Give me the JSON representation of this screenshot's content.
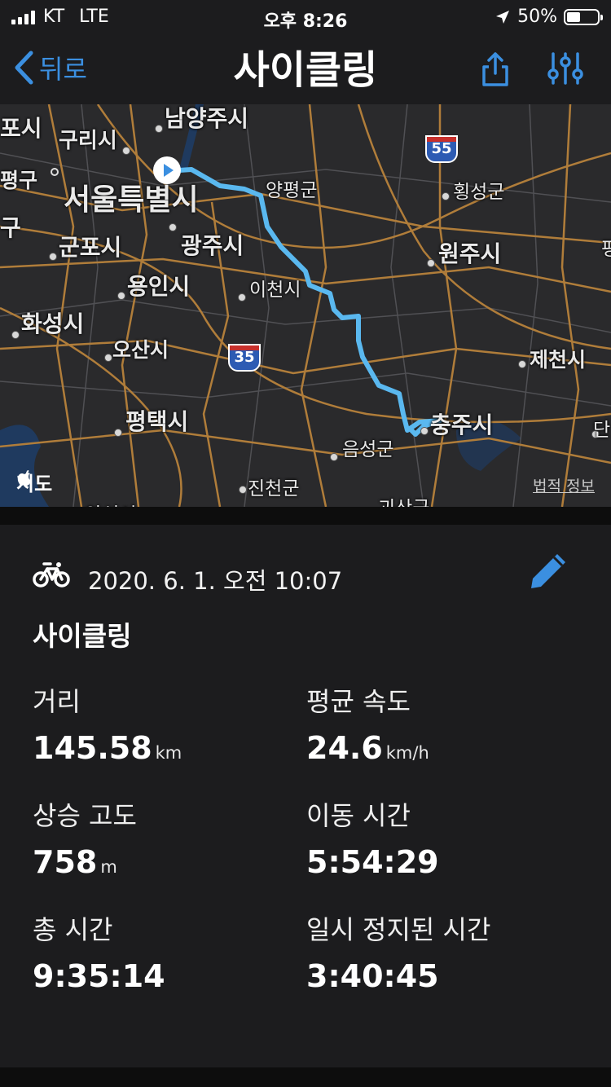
{
  "status_bar": {
    "carrier": "KT",
    "network": "LTE",
    "time": "오후 8:26",
    "battery": "50%"
  },
  "nav": {
    "back_label": "뒤로",
    "title": "사이클링"
  },
  "map": {
    "labels": {
      "namyangju": "남양주시",
      "guri": "구리시",
      "seoul": "서울특별시",
      "gunpo": "군포시",
      "gwangju": "광주시",
      "yongin": "용인시",
      "icheon": "이천시",
      "hwaseong": "화성시",
      "osan": "오산시",
      "pyeongtaek": "평택시",
      "yangpyeong": "양평군",
      "hoengseong": "횡성군",
      "wonju": "원주시",
      "jecheon": "제천시",
      "chungju": "충주시",
      "eumseong": "음성군",
      "jincheon": "진천군",
      "goesan": "괴산군",
      "edge_po": "포시",
      "edge_pyeong": "평구",
      "edge_gu": "구",
      "edge_pyeong_right": "평",
      "edge_dan": "단",
      "bottom_cut": "안성시"
    },
    "highway_a": "55",
    "highway_b": "35",
    "credit": "지도",
    "legal": "법적 정보",
    "route_color": "#5ab8ef"
  },
  "activity": {
    "datetime": "2020. 6. 1. 오전 10:07",
    "title": "사이클링",
    "metrics": {
      "distance": {
        "label": "거리",
        "value": "145.58",
        "unit": "km"
      },
      "avg_speed": {
        "label": "평균 속도",
        "value": "24.6",
        "unit": "km/h"
      },
      "elevation": {
        "label": "상승 고도",
        "value": "758",
        "unit": "m"
      },
      "moving_time": {
        "label": "이동 시간",
        "value": "5:54:29"
      },
      "total_time": {
        "label": "총 시간",
        "value": "9:35:14"
      },
      "paused_time": {
        "label": "일시 정지된 시간",
        "value": "3:40:45"
      }
    }
  },
  "colors": {
    "accent": "#3b8fe0",
    "background": "#1c1c1e",
    "road": "#b07d3a"
  }
}
